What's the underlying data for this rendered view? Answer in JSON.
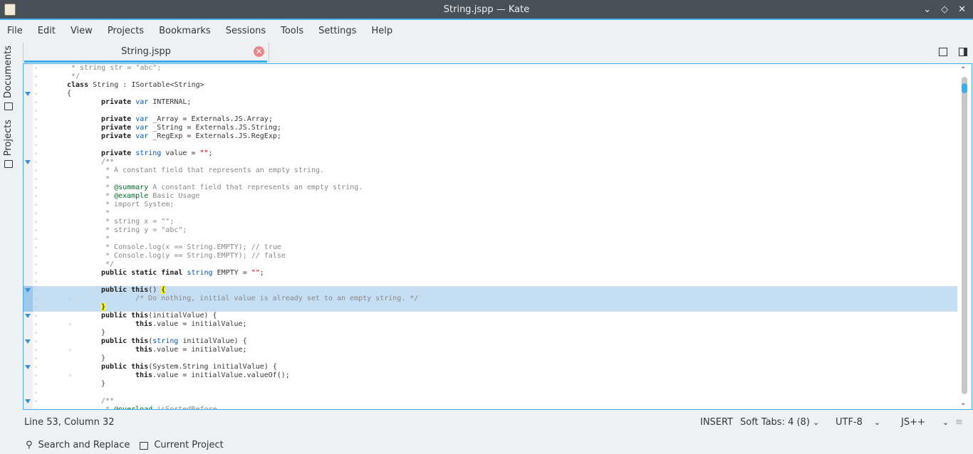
{
  "window": {
    "title": "String.jspp  — Kate",
    "controls": [
      "minimize",
      "maximize",
      "close"
    ]
  },
  "menu": [
    "File",
    "Edit",
    "View",
    "Projects",
    "Bookmarks",
    "Sessions",
    "Tools",
    "Settings",
    "Help"
  ],
  "sidebar": {
    "documents": "Documents",
    "projects": "Projects"
  },
  "tab": {
    "label": "String.jspp"
  },
  "colors": {
    "accent": "#3daee9",
    "keyword": "#1f1c1b",
    "type": "#0057ae",
    "string": "#bf0303",
    "comment": "#898887",
    "doctag": "#006e28",
    "selection": "#c5def2",
    "bracket_match": "#ffff00"
  },
  "code": [
    {
      "i": 1,
      "t": [
        [
          "cm",
          " * string str = \"abc\";"
        ]
      ]
    },
    {
      "i": 1,
      "t": [
        [
          "cm",
          " */"
        ]
      ]
    },
    {
      "i": 1,
      "t": [
        [
          "kw",
          "class"
        ],
        [
          "pl",
          " String : ISortable<String>"
        ]
      ]
    },
    {
      "i": 1,
      "f": 1,
      "t": [
        [
          "pl",
          "{"
        ]
      ]
    },
    {
      "i": 2,
      "t": [
        [
          "kw",
          "private"
        ],
        [
          "pl",
          " "
        ],
        [
          "ty",
          "var"
        ],
        [
          "pl",
          " INTERNAL;"
        ]
      ]
    },
    {
      "i": 2,
      "t": []
    },
    {
      "i": 2,
      "t": [
        [
          "kw",
          "private"
        ],
        [
          "pl",
          " "
        ],
        [
          "ty",
          "var"
        ],
        [
          "pl",
          " _Array = Externals.JS.Array;"
        ]
      ]
    },
    {
      "i": 2,
      "t": [
        [
          "kw",
          "private"
        ],
        [
          "pl",
          " "
        ],
        [
          "ty",
          "var"
        ],
        [
          "pl",
          " _String = Externals.JS.String;"
        ]
      ]
    },
    {
      "i": 2,
      "t": [
        [
          "kw",
          "private"
        ],
        [
          "pl",
          " "
        ],
        [
          "ty",
          "var"
        ],
        [
          "pl",
          " _RegExp = Externals.JS.RegExp;"
        ]
      ]
    },
    {
      "i": 2,
      "t": []
    },
    {
      "i": 2,
      "t": [
        [
          "kw",
          "private"
        ],
        [
          "pl",
          " "
        ],
        [
          "ty",
          "string"
        ],
        [
          "pl",
          " value = "
        ],
        [
          "st",
          "\"\""
        ],
        [
          "pl",
          ";"
        ]
      ]
    },
    {
      "i": 2,
      "f": 1,
      "t": [
        [
          "cm",
          "/**"
        ]
      ]
    },
    {
      "i": 2,
      "t": [
        [
          "cm",
          " * A constant field that represents an empty string."
        ]
      ]
    },
    {
      "i": 2,
      "t": [
        [
          "cm",
          " *"
        ]
      ]
    },
    {
      "i": 2,
      "t": [
        [
          "cm",
          " * "
        ],
        [
          "tg",
          "@summary"
        ],
        [
          "cm",
          " A constant field that represents an empty string."
        ]
      ]
    },
    {
      "i": 2,
      "t": [
        [
          "cm",
          " * "
        ],
        [
          "tg",
          "@example"
        ],
        [
          "cm",
          " Basic Usage"
        ]
      ]
    },
    {
      "i": 2,
      "t": [
        [
          "cm",
          " * import System;"
        ]
      ]
    },
    {
      "i": 2,
      "t": [
        [
          "cm",
          " *"
        ]
      ]
    },
    {
      "i": 2,
      "t": [
        [
          "cm",
          " * string x = \"\";"
        ]
      ]
    },
    {
      "i": 2,
      "t": [
        [
          "cm",
          " * string y = \"abc\";"
        ]
      ]
    },
    {
      "i": 2,
      "t": [
        [
          "cm",
          " *"
        ]
      ]
    },
    {
      "i": 2,
      "t": [
        [
          "cm",
          " * Console.log(x == String.EMPTY); // true"
        ]
      ]
    },
    {
      "i": 2,
      "t": [
        [
          "cm",
          " * Console.log(y == String.EMPTY); // false"
        ]
      ]
    },
    {
      "i": 2,
      "t": [
        [
          "cm",
          " */"
        ]
      ]
    },
    {
      "i": 2,
      "t": [
        [
          "kw",
          "public static final"
        ],
        [
          "pl",
          " "
        ],
        [
          "ty",
          "string"
        ],
        [
          "pl",
          " EMPTY = "
        ],
        [
          "st",
          "\"\""
        ],
        [
          "pl",
          ";"
        ]
      ]
    },
    {
      "i": 2,
      "t": []
    },
    {
      "i": 2,
      "f": 1,
      "h": 1,
      "t": [
        [
          "kw",
          "public this"
        ],
        [
          "pl",
          "() "
        ],
        [
          "br",
          "{"
        ]
      ]
    },
    {
      "i": 3,
      "h": 1,
      "t": [
        [
          "cm",
          "/* Do nothing, initial value is already set to an empty string. */"
        ]
      ]
    },
    {
      "i": 2,
      "h": 1,
      "t": [
        [
          "br",
          "}"
        ]
      ]
    },
    {
      "i": 2,
      "f": 1,
      "t": [
        [
          "kw",
          "public this"
        ],
        [
          "pl",
          "(initialValue) {"
        ]
      ]
    },
    {
      "i": 3,
      "t": [
        [
          "kw",
          "this"
        ],
        [
          "pl",
          ".value = initialValue;"
        ]
      ]
    },
    {
      "i": 2,
      "t": [
        [
          "pl",
          "}"
        ]
      ]
    },
    {
      "i": 2,
      "f": 1,
      "t": [
        [
          "kw",
          "public this"
        ],
        [
          "pl",
          "("
        ],
        [
          "ty",
          "string"
        ],
        [
          "pl",
          " initialValue) {"
        ]
      ]
    },
    {
      "i": 3,
      "t": [
        [
          "kw",
          "this"
        ],
        [
          "pl",
          ".value = initialValue;"
        ]
      ]
    },
    {
      "i": 2,
      "t": [
        [
          "pl",
          "}"
        ]
      ]
    },
    {
      "i": 2,
      "f": 1,
      "t": [
        [
          "kw",
          "public this"
        ],
        [
          "pl",
          "(System.String initialValue) {"
        ]
      ]
    },
    {
      "i": 3,
      "t": [
        [
          "kw",
          "this"
        ],
        [
          "pl",
          ".value = initialValue.valueOf();"
        ]
      ]
    },
    {
      "i": 2,
      "t": [
        [
          "pl",
          "}"
        ]
      ]
    },
    {
      "i": 2,
      "t": []
    },
    {
      "i": 2,
      "f": 1,
      "t": [
        [
          "cm",
          "/**"
        ]
      ]
    },
    {
      "i": 2,
      "t": [
        [
          "cm",
          " * "
        ],
        [
          "tg",
          "@overload"
        ],
        [
          "cm",
          " isSortedBefore"
        ]
      ]
    }
  ],
  "scrollbar": {
    "position_fraction": 0.02
  },
  "status": {
    "cursor": "Line 53, Column 32",
    "mode": "INSERT",
    "indent": "Soft Tabs: 4 (8)",
    "encoding": "UTF-8",
    "syntax": "JS++"
  },
  "bottom": {
    "search": "Search and Replace",
    "project": "Current Project"
  }
}
